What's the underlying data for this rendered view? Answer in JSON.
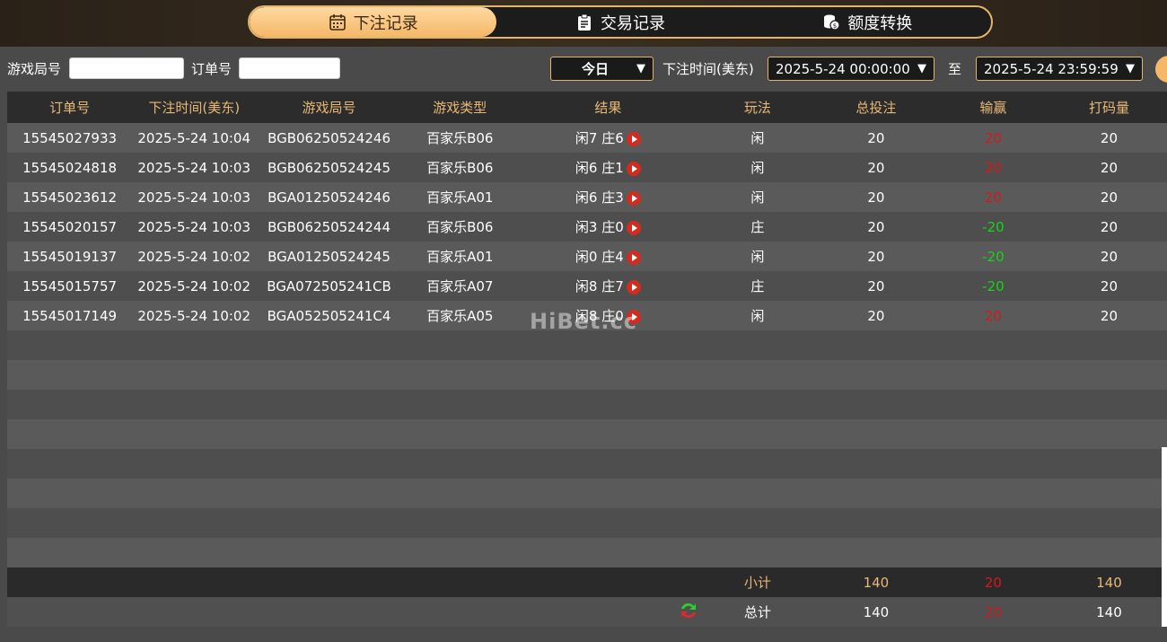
{
  "tabs": [
    {
      "label": "下注记录",
      "icon": "calendar-icon",
      "active": true
    },
    {
      "label": "交易记录",
      "icon": "clipboard-icon",
      "active": false
    },
    {
      "label": "额度转换",
      "icon": "coins-icon",
      "active": false
    }
  ],
  "filters": {
    "round_label": "游戏局号",
    "round_value": "",
    "order_label": "订单号",
    "order_value": "",
    "period_value": "今日",
    "time_label": "下注时间(美东)",
    "start_value": "2025-5-24 00:00:00",
    "to_label": "至",
    "end_value": "2025-5-24 23:59:59"
  },
  "table": {
    "headers": [
      "订单号",
      "下注时间(美东)",
      "游戏局号",
      "游戏类型",
      "结果",
      "玩法",
      "总投注",
      "输赢",
      "打码量"
    ],
    "rows": [
      [
        "15545027933",
        "2025-5-24 10:04",
        "BGB06250524246",
        "百家乐B06",
        "闲7 庄6",
        "闲",
        "20",
        "20",
        "20"
      ],
      [
        "15545024818",
        "2025-5-24 10:03",
        "BGB06250524245",
        "百家乐B06",
        "闲6 庄1",
        "闲",
        "20",
        "20",
        "20"
      ],
      [
        "15545023612",
        "2025-5-24 10:03",
        "BGA01250524246",
        "百家乐A01",
        "闲6 庄3",
        "闲",
        "20",
        "20",
        "20"
      ],
      [
        "15545020157",
        "2025-5-24 10:03",
        "BGB06250524244",
        "百家乐B06",
        "闲3 庄0",
        "庄",
        "20",
        "-20",
        "20"
      ],
      [
        "15545019137",
        "2025-5-24 10:02",
        "BGA01250524245",
        "百家乐A01",
        "闲0 庄4",
        "闲",
        "20",
        "-20",
        "20"
      ],
      [
        "15545015757",
        "2025-5-24 10:02",
        "BGA072505241CB",
        "百家乐A07",
        "闲8 庄7",
        "庄",
        "20",
        "-20",
        "20"
      ],
      [
        "15545017149",
        "2025-5-24 10:02",
        "BGA052505241C4",
        "百家乐A05",
        "闲8 庄0",
        "闲",
        "20",
        "20",
        "20"
      ]
    ],
    "empty_rows": 8,
    "subtotal": {
      "label": "小计",
      "bet": "140",
      "winloss": "20",
      "turnover": "140"
    },
    "total": {
      "label": "总计",
      "bet": "140",
      "winloss": "20",
      "turnover": "140"
    }
  },
  "watermark": "HiBet.cc",
  "colors": {
    "accent": "#e8b876",
    "win": "#d41a1a",
    "loss": "#17d317"
  }
}
